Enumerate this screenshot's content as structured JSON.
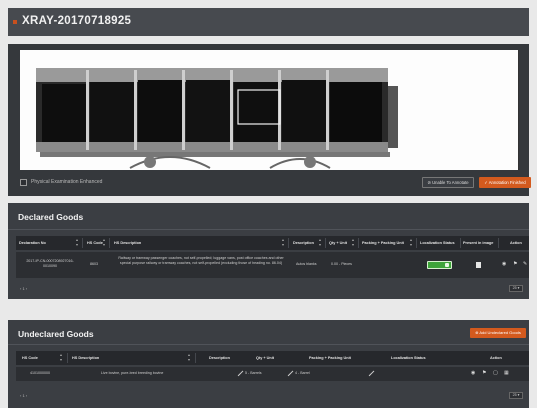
{
  "header": {
    "title": "XRAY-20170718925"
  },
  "image_panel": {
    "checkbox_label": "Physical Examination Enhanced",
    "annotate_button": "Unable To Annotate",
    "finish_button": "Annotation Finished"
  },
  "declared": {
    "title": "Declared Goods",
    "columns": [
      "Declaration No",
      "HS Code",
      "HS Description",
      "Description",
      "Qty + Unit",
      "Packing + Packing Unit",
      "Localization Status",
      "Present in image",
      "Action"
    ],
    "rows": [
      {
        "declaration_no": "2017-IP-CN-0007208927016-0010090",
        "hs_code": "8603",
        "hs_description": "Railway or tramway passenger coaches, not self-propelled; luggage vans, post office coaches and other special purpose railway or tramway coaches, not self-propelled (excluding those of heading no. 86.04)",
        "description": "Autos blanks",
        "qty_unit": "0.00 - Pieces",
        "packing": "",
        "present": "▪",
        "actions": [
          "◉",
          "⚑",
          "✎"
        ]
      }
    ],
    "pager": "‹ 1 ›",
    "page_size": "25 ▾"
  },
  "undeclared": {
    "title": "Undeclared Goods",
    "add_button": "Add Undeclared Goods",
    "columns": [
      "HS Code",
      "HS Description",
      "Description",
      "Qty + Unit",
      "Packing + Packing Unit",
      "Localization Status",
      "Action"
    ],
    "rows": [
      {
        "hs_code": "4101000000",
        "hs_description": "Live bovine, pure-bred breeding bovine",
        "qty_unit": "5 - Barrels",
        "packing": "4 - Barrel",
        "actions": [
          "◉",
          "⚑",
          "▢",
          "▦"
        ]
      }
    ],
    "pager": "‹ 1 ›",
    "page_size": "25 ▾"
  }
}
